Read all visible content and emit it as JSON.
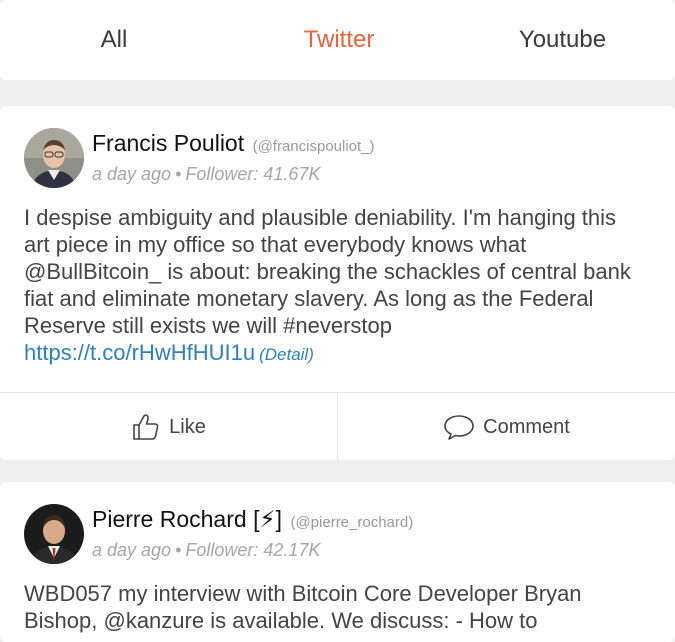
{
  "tabs": [
    {
      "label": "All",
      "active": false
    },
    {
      "label": "Twitter",
      "active": true
    },
    {
      "label": "Youtube",
      "active": false
    }
  ],
  "colors": {
    "accent": "#e8643a",
    "link": "#2f7fc1",
    "background": "#efefef"
  },
  "posts": [
    {
      "author": "Francis Pouliot",
      "handle": "(@francispouliot_)",
      "time": "a day ago",
      "followers": "Follower: 41.67K",
      "text": "I despise ambiguity and plausible deniability. I'm hanging this art piece in my office so that everybody knows what @BullBitcoin_ is about: breaking the schackles of central bank fiat and eliminate monetary slavery. As long as the Federal Reserve still exists we will #neverstop",
      "link": "https://t.co/rHwHfHUI1u",
      "detail": "(Detail)",
      "actions": {
        "like": "Like",
        "comment": "Comment"
      }
    },
    {
      "author": "Pierre Rochard [⚡]",
      "handle": "(@pierre_rochard)",
      "time": "a day ago",
      "followers": "Follower: 42.17K",
      "text": "WBD057 my interview with Bitcoin Core Developer Bryan Bishop, @kanzure is available. We discuss: - How to"
    }
  ]
}
